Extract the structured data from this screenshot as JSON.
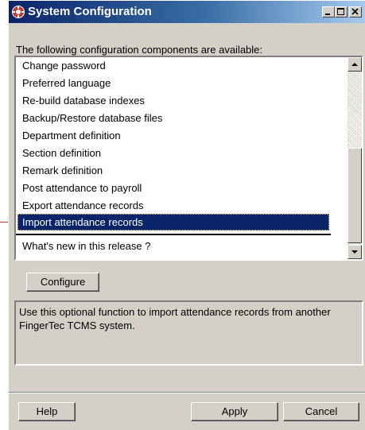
{
  "window": {
    "title": "System Configuration",
    "controls": {
      "minimize": "minimize-icon",
      "maximize": "maximize-icon",
      "close": "close-icon"
    }
  },
  "prompt": "The following configuration components are available:",
  "components": [
    "Change password",
    "Preferred language",
    "Re-build database indexes",
    "Backup/Restore database files",
    "Department definition",
    "Section definition",
    "Remark definition",
    "Post attendance to payroll",
    "Export attendance records",
    "Import attendance records"
  ],
  "selected_component": "Import attendance records",
  "extra_item": "What's new in this release ?",
  "buttons": {
    "configure": "Configure",
    "help": "Help",
    "apply": "Apply",
    "cancel": "Cancel"
  },
  "description": "Use this optional function to import attendance records from another FingerTec TCMS system.",
  "colors": {
    "titlebar": "#0a246a",
    "selection": "#0a246a",
    "face": "#d4d0c8"
  }
}
